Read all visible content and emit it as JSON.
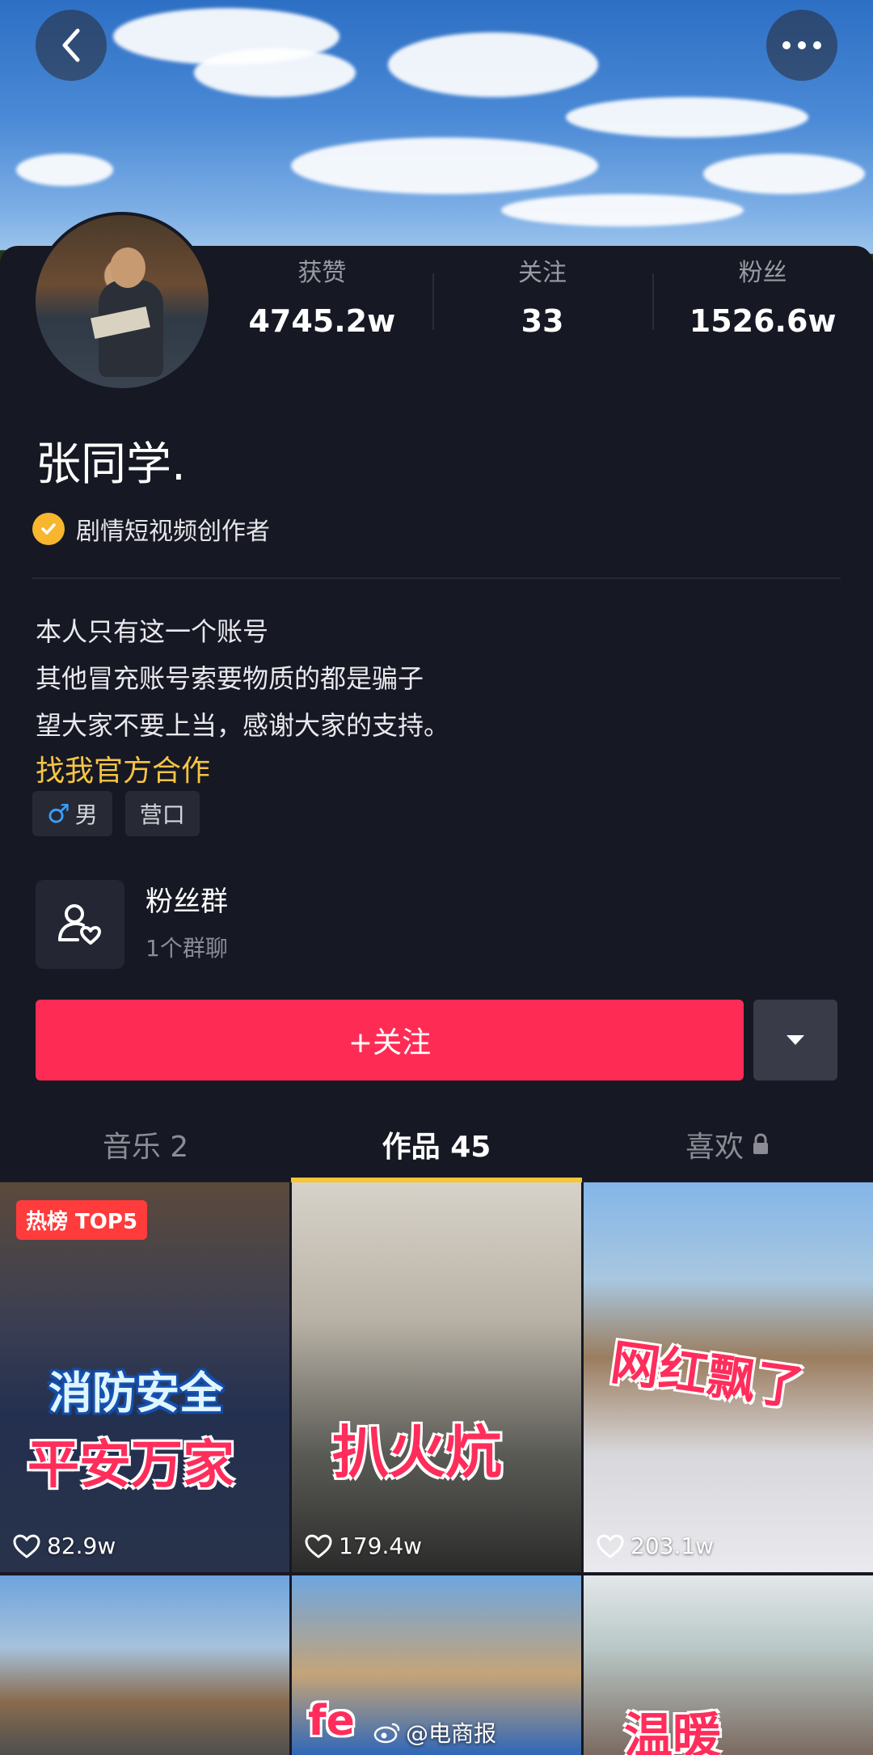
{
  "header": {
    "back_icon": "chevron-left-icon",
    "more_icon": "more-dots-icon"
  },
  "profile": {
    "name": "张同学.",
    "verification": "剧情短视频创作者",
    "stats": [
      {
        "label": "获赞",
        "value": "4745.2w"
      },
      {
        "label": "关注",
        "value": "33"
      },
      {
        "label": "粉丝",
        "value": "1526.6w"
      }
    ],
    "bio_lines": [
      "本人只有这一个账号",
      "其他冒充账号索要物质的都是骗子",
      "望大家不要上当，感谢大家的支持。"
    ],
    "bio_link": "找我官方合作",
    "tags": {
      "gender": "男",
      "gender_icon": "♂",
      "location": "营口"
    }
  },
  "fan_group": {
    "title": "粉丝群",
    "subtitle": "1个群聊"
  },
  "actions": {
    "follow_label": "+关注"
  },
  "tabs": [
    {
      "label": "音乐 2"
    },
    {
      "label": "作品 45"
    },
    {
      "label": "喜欢"
    }
  ],
  "videos": [
    {
      "likes": "82.9w",
      "badge": "热榜 TOP5",
      "title_top": "消防安全",
      "title_bottom": "平安万家"
    },
    {
      "likes": "179.4w",
      "title": "扒火炕"
    },
    {
      "likes": "203.1w",
      "title": "网红飘了"
    },
    {
      "likes": ""
    },
    {
      "likes": "",
      "title": "fe"
    },
    {
      "likes": "",
      "title": "温暖"
    }
  ],
  "watermark": "@电商报",
  "colors": {
    "accent": "#fe2c55",
    "tab_indicator": "#f7c631",
    "link": "#f6c445",
    "background": "#161823"
  }
}
